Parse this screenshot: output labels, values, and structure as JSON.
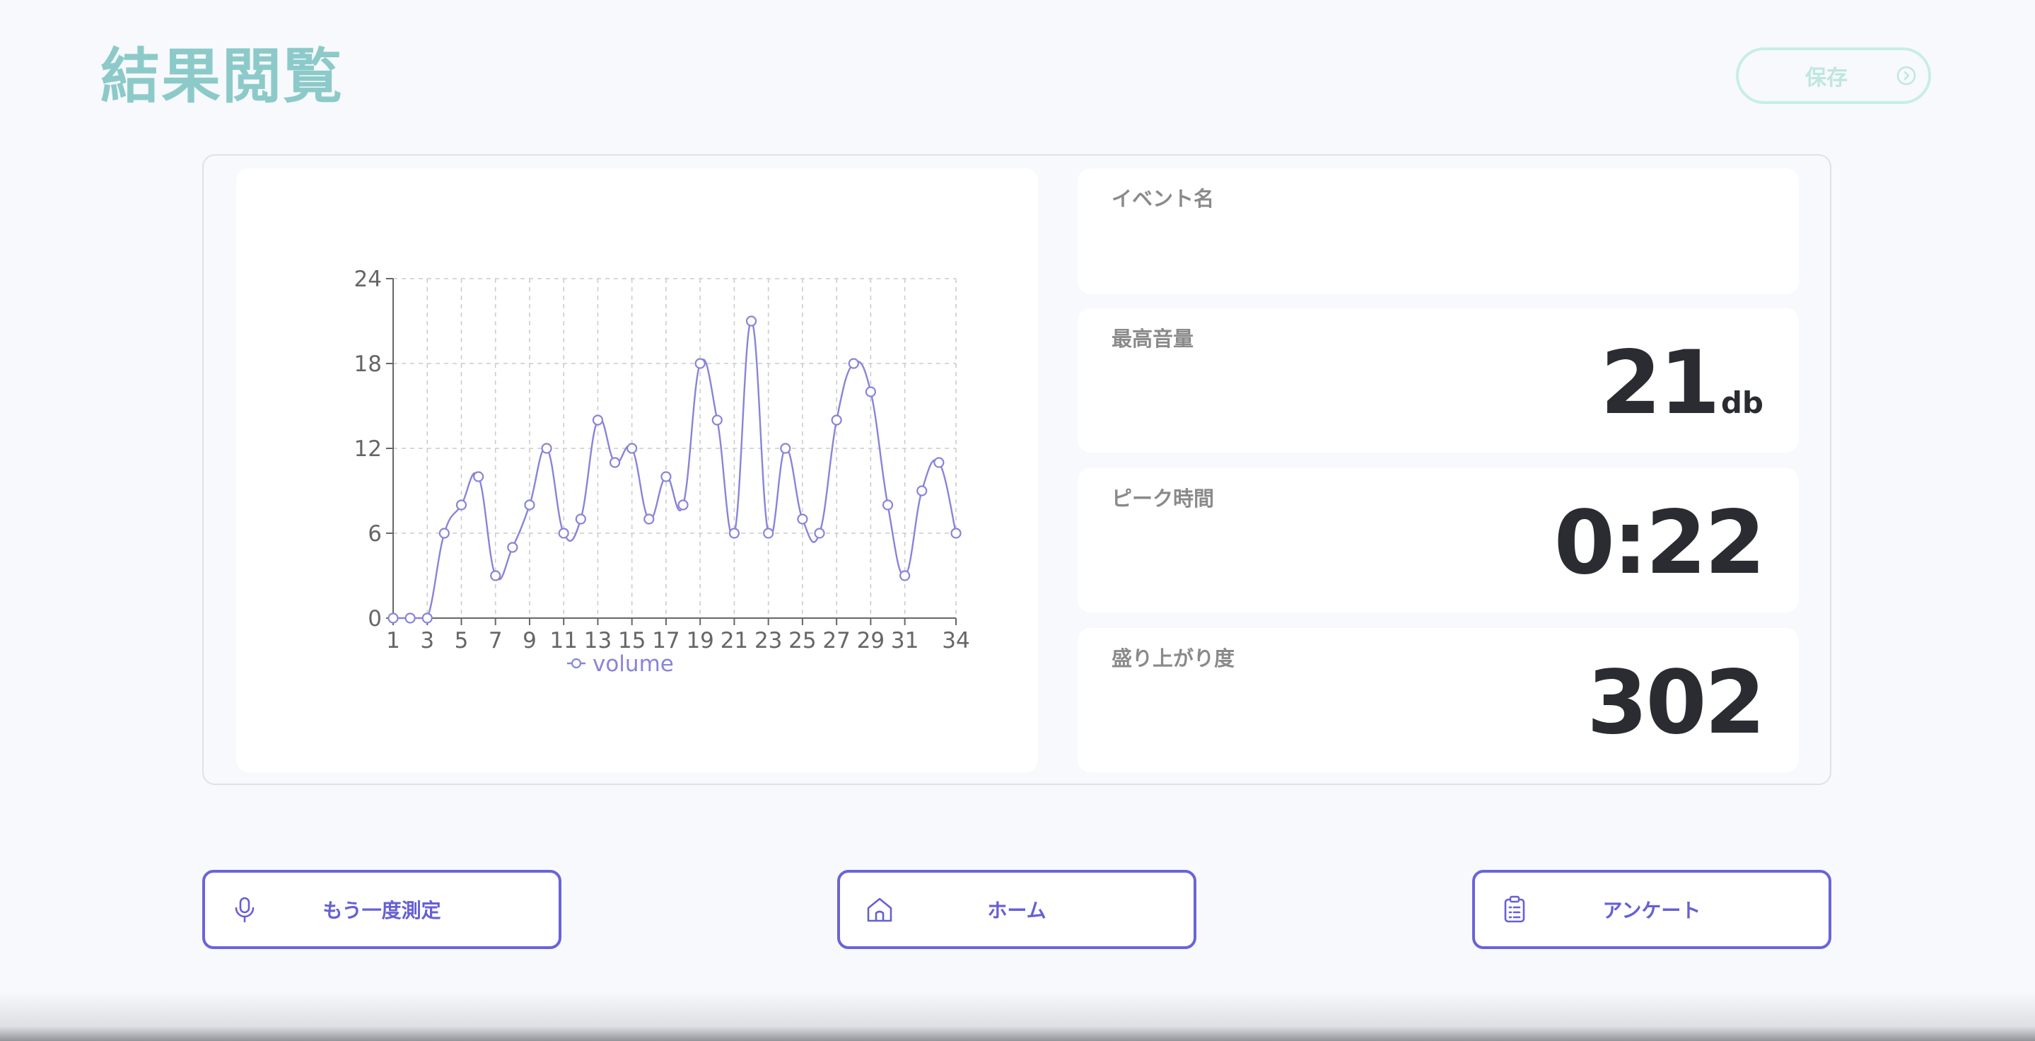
{
  "page": {
    "title": "結果閲覧",
    "save_label": "保存"
  },
  "stats": {
    "event_name": {
      "label": "イベント名",
      "value": ""
    },
    "max_volume": {
      "label": "最高音量",
      "value": "21",
      "unit": "db"
    },
    "peak_time": {
      "label": "ピーク時間",
      "value": "0:22"
    },
    "excitement": {
      "label": "盛り上がり度",
      "value": "302"
    }
  },
  "actions": {
    "retry_label": "もう一度測定",
    "home_label": "ホーム",
    "survey_label": "アンケート"
  },
  "icons": {
    "save": "chevron-right-circle-icon",
    "retry": "microphone-icon",
    "home": "home-icon",
    "survey": "clipboard-icon"
  },
  "colors": {
    "title": "#8ccac9",
    "save_border": "#c8ede8",
    "accent": "#6a64d8",
    "series": "#8884d8",
    "value_text": "#2a2c31"
  },
  "chart_data": {
    "type": "line",
    "x": [
      1,
      2,
      3,
      4,
      5,
      6,
      7,
      8,
      9,
      10,
      11,
      12,
      13,
      14,
      15,
      16,
      17,
      18,
      19,
      20,
      21,
      22,
      23,
      24,
      25,
      26,
      27,
      28,
      29,
      30,
      31,
      32,
      33,
      34
    ],
    "xticks": [
      "1",
      "3",
      "5",
      "7",
      "9",
      "11",
      "13",
      "15",
      "17",
      "19",
      "21",
      "23",
      "25",
      "27",
      "29",
      "31",
      "34"
    ],
    "yticks": [
      "0",
      "6",
      "12",
      "18",
      "24"
    ],
    "ylim": [
      0,
      24
    ],
    "grid": true,
    "legend": "bottom",
    "series": [
      {
        "name": "volume",
        "values": [
          0,
          0,
          0,
          6,
          8,
          10,
          3,
          5,
          8,
          12,
          6,
          7,
          14,
          11,
          12,
          7,
          10,
          8,
          18,
          14,
          6,
          21,
          6,
          12,
          7,
          6,
          14,
          18,
          16,
          8,
          3,
          9,
          11,
          6
        ]
      }
    ]
  }
}
